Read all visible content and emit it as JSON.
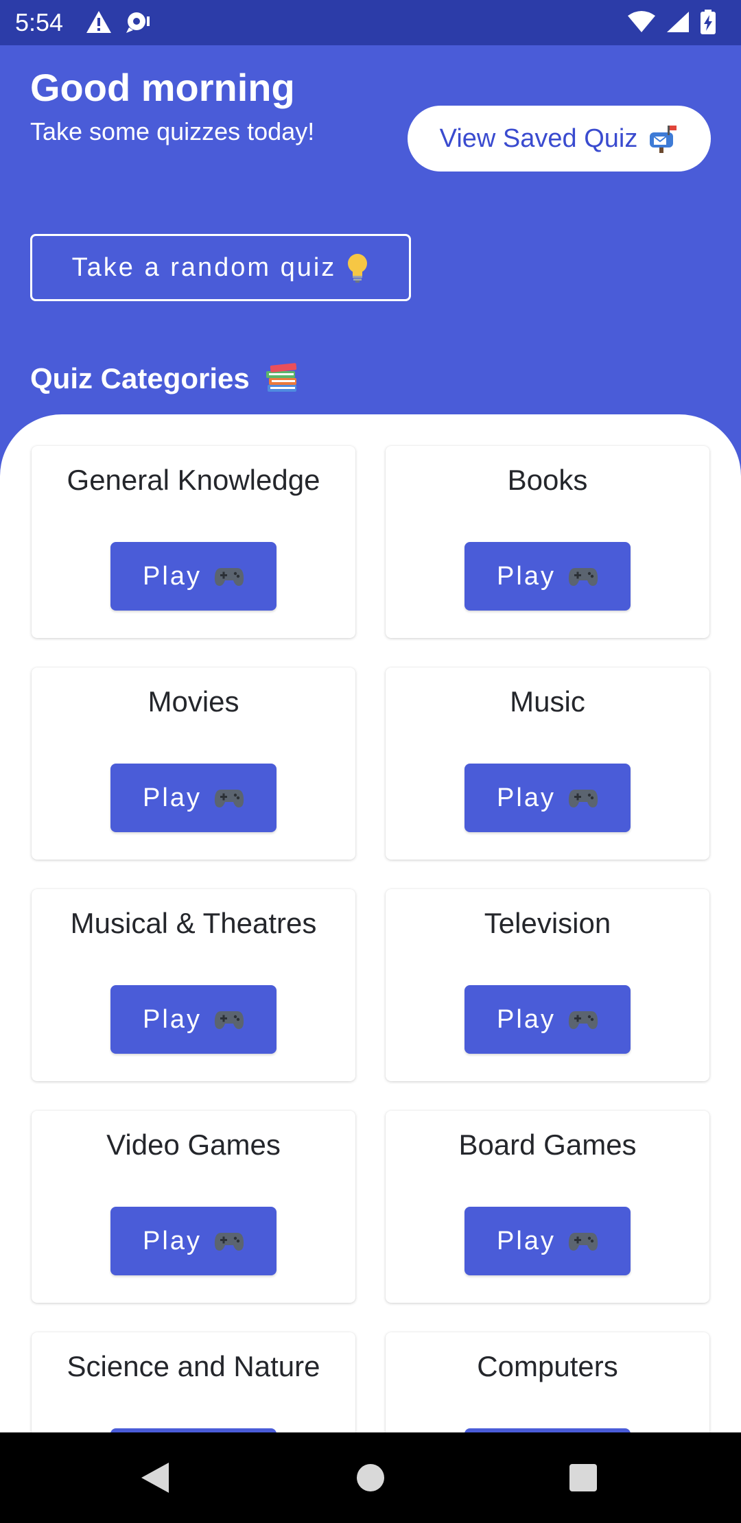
{
  "status_bar": {
    "time": "5:54",
    "icons": [
      "warning-icon",
      "notification-icon",
      "wifi-icon",
      "signal-icon",
      "battery-charging-icon"
    ]
  },
  "header": {
    "greeting": "Good morning",
    "subtitle": "Take some quizzes today!",
    "saved_quiz_label": "View Saved Quiz",
    "saved_quiz_icon": "mailbox-icon",
    "random_quiz_label": "Take a random quiz",
    "random_quiz_icon": "lightbulb-icon"
  },
  "categories_section": {
    "title": "Quiz Categories",
    "title_icon": "books-icon",
    "play_label": "Play",
    "play_icon": "game-controller-icon",
    "items": [
      {
        "name": "General Knowledge"
      },
      {
        "name": "Books"
      },
      {
        "name": "Movies"
      },
      {
        "name": "Music"
      },
      {
        "name": "Musical & Theatres"
      },
      {
        "name": "Television"
      },
      {
        "name": "Video Games"
      },
      {
        "name": "Board Games"
      },
      {
        "name": "Science and Nature"
      },
      {
        "name": "Computers"
      }
    ]
  },
  "nav_bar": {
    "icons": [
      "back-icon",
      "home-icon",
      "recents-icon"
    ]
  },
  "colors": {
    "primary": "#4A5CD8",
    "status_bar": "#2C3CA8",
    "on_primary": "#FFFFFF",
    "card_text": "#24262B"
  }
}
